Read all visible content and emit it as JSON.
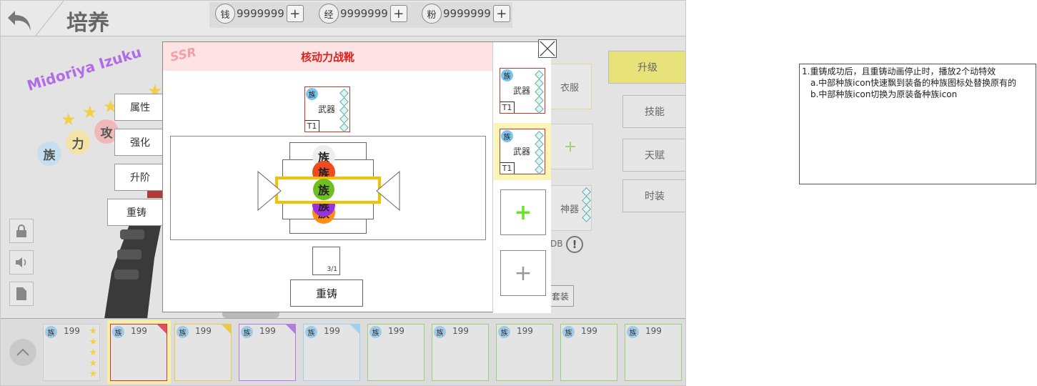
{
  "header": {
    "title": "培养"
  },
  "currencies": [
    {
      "icon_label": "钱",
      "value": "9999999",
      "plus": "+"
    },
    {
      "icon_label": "经",
      "value": "9999999",
      "plus": "+"
    },
    {
      "icon_label": "粉",
      "value": "9999999",
      "plus": "+"
    }
  ],
  "character": {
    "name": "Midoriya Izuku",
    "tags": [
      "族",
      "力",
      "攻"
    ]
  },
  "side_buttons": [
    "属性",
    "强化",
    "升阶",
    "重铸"
  ],
  "right_menu": [
    "升级",
    "技能",
    "天赋",
    "时装"
  ],
  "equip_slots_bg": {
    "clothes": "衣服",
    "artifact": "神器",
    "plus": "+",
    "fashion_btn": "套装",
    "partial_text": "DB",
    "info": "!"
  },
  "modal": {
    "rarity": "SSR",
    "title": "核动力战靴",
    "equip": {
      "badge": "族",
      "name": "武器",
      "tier": "T1"
    },
    "reel_labels": [
      "族",
      "族",
      "族",
      "族",
      "族"
    ],
    "material_count": "3/1",
    "recast_label": "重铸",
    "right_slots": [
      {
        "badge": "族",
        "name": "武器",
        "tier": "T1"
      },
      {
        "badge": "族",
        "name": "武器",
        "tier": "T1"
      }
    ],
    "add_labels": [
      "+",
      "+"
    ]
  },
  "inventory": {
    "cards": [
      {
        "badge": "族",
        "count": "199"
      },
      {
        "badge": "族",
        "count": "199"
      },
      {
        "badge": "族",
        "count": "199"
      },
      {
        "badge": "族",
        "count": "199"
      },
      {
        "badge": "族",
        "count": "199"
      },
      {
        "badge": "族",
        "count": "199"
      },
      {
        "badge": "族",
        "count": "199"
      },
      {
        "badge": "族",
        "count": "199"
      },
      {
        "badge": "族",
        "count": "199"
      },
      {
        "badge": "族",
        "count": "199"
      }
    ]
  },
  "note": {
    "lines": [
      "1.重铸成功后，且重铸动画停止时，播放2个动特效",
      "   a.中部种族icon快速飘到装备的种族图标处替换原有的",
      "   b.中部种族icon切换为原装备种族icon"
    ]
  },
  "colors": {
    "accent_upgrade": "#e8e27a",
    "title_red": "#e0201a",
    "highlight_yellow": "#f2c200",
    "name_purple": "#b06ce8"
  }
}
